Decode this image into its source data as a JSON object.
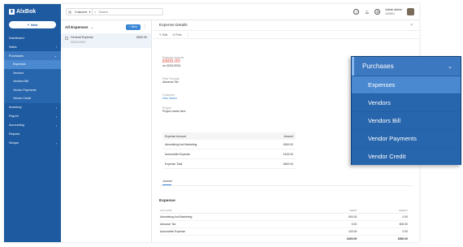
{
  "app": {
    "logo": "AlxBok",
    "new_label": "New"
  },
  "sidebar": {
    "items": [
      {
        "label": "Dashboard"
      },
      {
        "label": "Sales",
        "chevron": "›"
      },
      {
        "label": "Purchases",
        "chevron": "⌄"
      }
    ],
    "purchases_sub": [
      "Expenses",
      "Vendors",
      "Vendors Bill",
      "Vendor Payments",
      "Vendor Credit"
    ],
    "items_after": [
      {
        "label": "Inventory",
        "chevron": "›"
      },
      {
        "label": "Payroll",
        "chevron": "›"
      },
      {
        "label": "Accounting",
        "chevron": "›"
      },
      {
        "label": "Reports"
      },
      {
        "label": "Setups",
        "chevron": "›"
      }
    ]
  },
  "topbar": {
    "search_scope": "Customer",
    "search_placeholder": "Search",
    "user_name": "Admin Admin",
    "user_role": "ADMIN"
  },
  "list": {
    "title": "All Expenses",
    "new_label": "+ New",
    "rows": [
      {
        "name": "General Expense",
        "date": "03/01/2024",
        "amount": "£600.00"
      }
    ]
  },
  "detail": {
    "title": "Expense Details",
    "edit_label": "Edit",
    "print_label": "Print",
    "amount_label": "Expense Amount",
    "amount_value": "£600.00",
    "amount_date": "on 03/01/2024",
    "paid_through_label": "Paid Through",
    "paid_through_value": "Advance Tax",
    "customer_label": "Customer",
    "customer_value": "Irfan Nazim",
    "project_label": "Project",
    "project_value": "Project name here",
    "table_headers": [
      "Expense Account",
      "Amount"
    ],
    "table_rows": [
      [
        "Advertising And Marketing",
        "£500.00"
      ],
      [
        "Automobile Expense",
        "£100.00"
      ],
      [
        "Expense Total",
        "£600.00"
      ]
    ],
    "journal_tab": "Journal",
    "journal_title": "Expense",
    "journal_headers": [
      "ACCOUNT",
      "DEBIT",
      "CREDIT"
    ],
    "journal_rows": [
      [
        "Advertising And Marketing",
        "500.00",
        "0.00"
      ],
      [
        "Advance Tax",
        "0.00",
        "600.00"
      ],
      [
        "Automobile Expense",
        "100.00",
        "0.00"
      ]
    ],
    "journal_totals": [
      "£600.00",
      "£600.00"
    ]
  },
  "callout": {
    "title": "Purchases",
    "items": [
      "Expenses",
      "Vendors",
      "Vendors Bill",
      "Vendor Payments",
      "Vendor Credit"
    ]
  }
}
